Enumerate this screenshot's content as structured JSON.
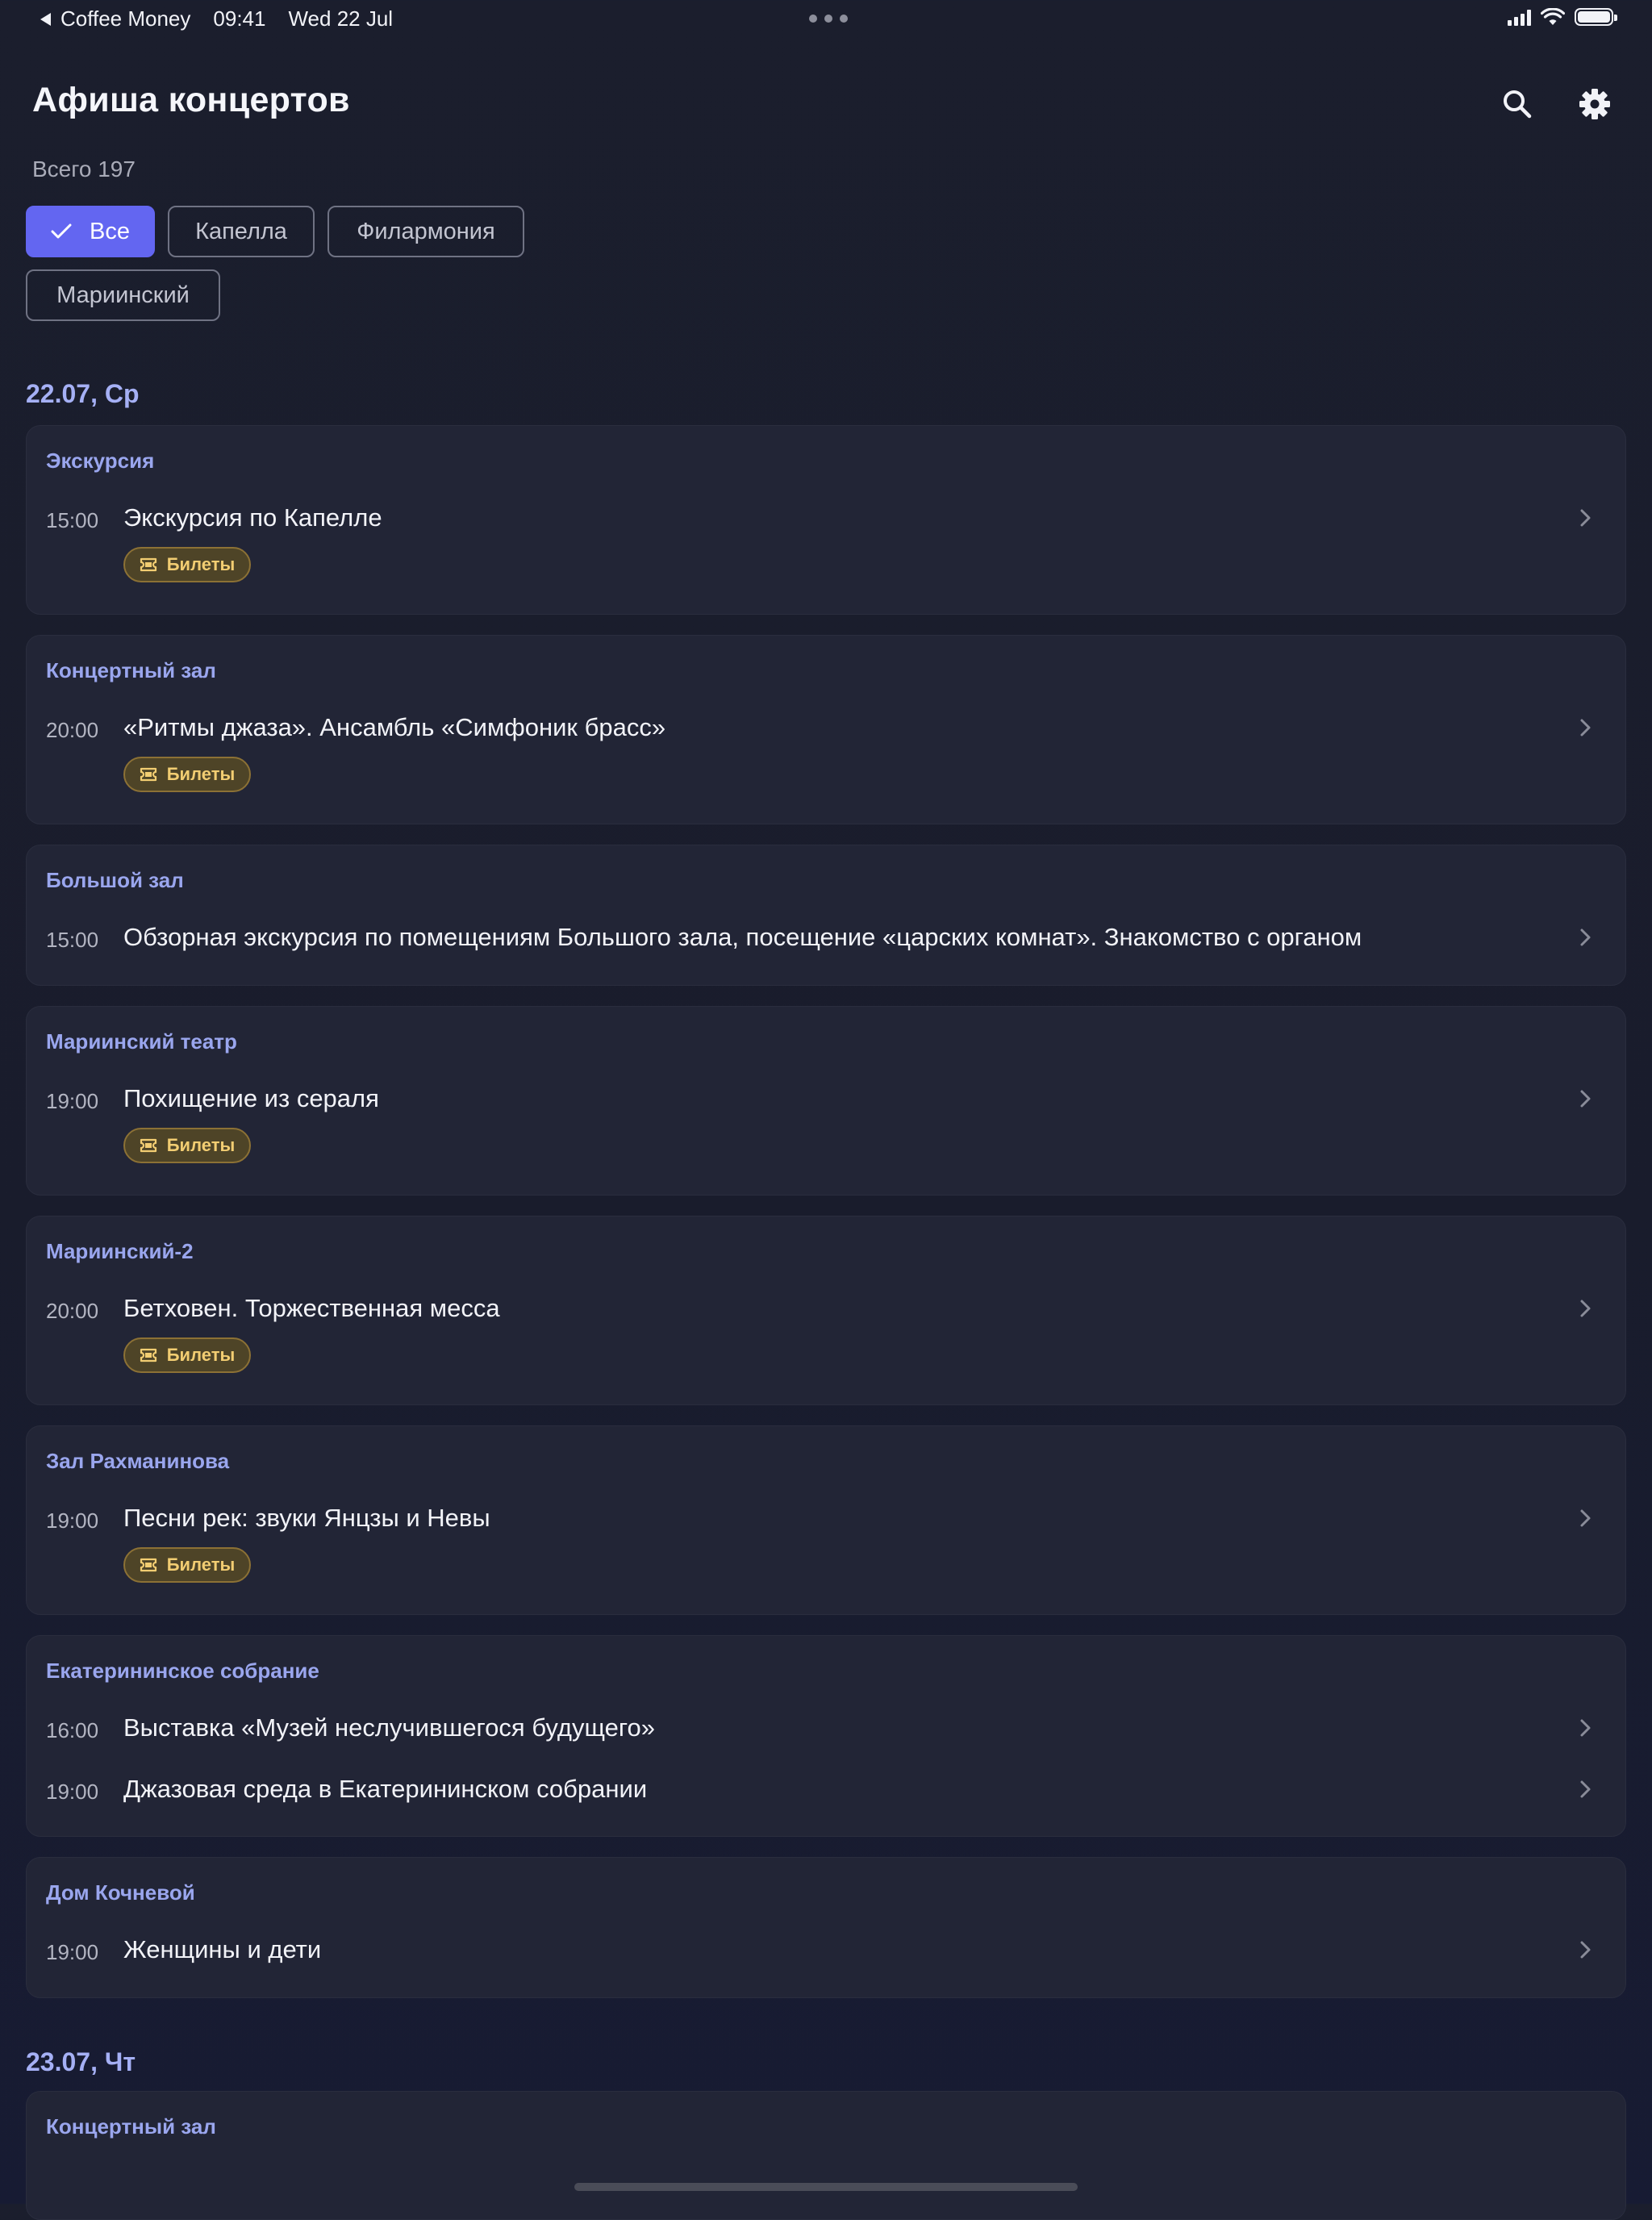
{
  "status_bar": {
    "back_app": "Coffee Money",
    "time": "09:41",
    "date": "Wed 22 Jul"
  },
  "header": {
    "title": "Афиша концертов",
    "total": "Всего 197",
    "icons": [
      "search-icon",
      "gear-icon"
    ]
  },
  "filters": {
    "chips": [
      {
        "label": "Все",
        "selected": true
      },
      {
        "label": "Капелла",
        "selected": false
      },
      {
        "label": "Филармония",
        "selected": false
      },
      {
        "label": "Мариинский",
        "selected": false
      }
    ]
  },
  "days": [
    {
      "date": "22.07, Ср",
      "venues": [
        {
          "name": "Экскурсия",
          "events": [
            {
              "time": "15:00",
              "title": "Экскурсия по Капелле",
              "tickets": "Билеты"
            }
          ]
        },
        {
          "name": "Концертный зал",
          "events": [
            {
              "time": "20:00",
              "title": "«Ритмы джаза». Ансамбль «Симфоник брасс»",
              "tickets": "Билеты"
            }
          ]
        },
        {
          "name": "Большой зал",
          "events": [
            {
              "time": "15:00",
              "title": "Обзорная экскурсия по помещениям Большого зала, посещение «царских комнат». Знакомство с органом"
            }
          ]
        },
        {
          "name": "Мариинский театр",
          "events": [
            {
              "time": "19:00",
              "title": "Похищение из сераля",
              "tickets": "Билеты"
            }
          ]
        },
        {
          "name": "Мариинский-2",
          "events": [
            {
              "time": "20:00",
              "title": "Бетховен. Торжественная месса",
              "tickets": "Билеты"
            }
          ]
        },
        {
          "name": "Зал Рахманинова",
          "events": [
            {
              "time": "19:00",
              "title": "Песни рек: звуки Янцзы и Невы",
              "tickets": "Билеты"
            }
          ]
        },
        {
          "name": "Екатерининское собрание",
          "events": [
            {
              "time": "16:00",
              "title": "Выставка «Музей неслучившегося будущего»"
            },
            {
              "time": "19:00",
              "title": "Джазовая среда в Екатерининском собрании"
            }
          ]
        },
        {
          "name": "Дом Кочневой",
          "events": [
            {
              "time": "19:00",
              "title": "Женщины и дети"
            }
          ]
        }
      ]
    },
    {
      "date": "23.07, Чт",
      "venues": [
        {
          "name": "Концертный зал",
          "events": []
        }
      ]
    }
  ],
  "colors": {
    "accent": "#6366f1",
    "venue_label": "#9aa6ee",
    "ticket_text": "#f2cd72",
    "card_bg": "#222536"
  }
}
